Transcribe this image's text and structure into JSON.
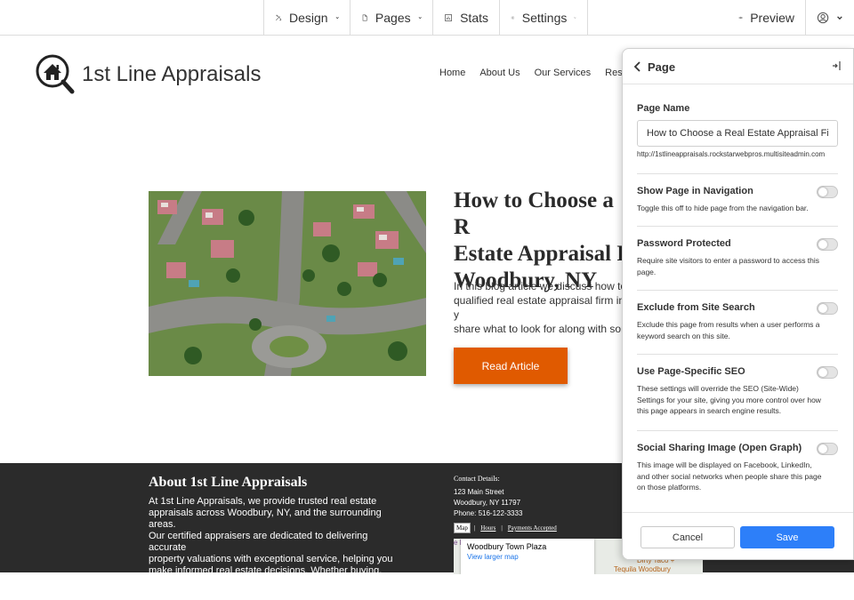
{
  "toolbar": {
    "design_label": "Design",
    "pages_label": "Pages",
    "stats_label": "Stats",
    "settings_label": "Settings",
    "preview_label": "Preview"
  },
  "site": {
    "name": "1st Line Appraisals",
    "nav": [
      "Home",
      "About Us",
      "Our Services",
      "Resour"
    ]
  },
  "article": {
    "title": "How to Choose a R\nEstate Appraisal F\nWoodbury, NY",
    "excerpt": "In this blog article we discuss how to\nqualified real estate appraisal firm in y\nshare what to look for along with som\nchoosing the best firm to meet your n",
    "read_label": "Read Article"
  },
  "footer": {
    "title": "About 1st Line Appraisals",
    "text": "At 1st Line Appraisals, we provide trusted real estate\nappraisals across Woodbury, NY, and the surrounding areas.\nOur certified appraisers are dedicated to delivering accurate\nproperty valuations with exceptional service, helping you\nmake informed real estate decisions. Whether buying,\nselling, or refinancing, we're here to support you every step\nof the way.",
    "contact_heading": "Contact Details:",
    "address1": "123 Main Street",
    "address2": "Woodbury, NY 11797",
    "phone": "Phone: 516-122-3333",
    "map_tabs": [
      "Map",
      "Hours",
      "Payments Accepted"
    ],
    "map_place": "Woodbury Town Plaza",
    "map_link": "View larger map",
    "map_label_1": "e Mansion",
    "map_label_2": "Dirty Taco +",
    "map_label_3": "Tequila Woodbury"
  },
  "panel": {
    "title": "Page",
    "page_name_label": "Page Name",
    "page_name_value": "How to Choose a Real Estate Appraisal Firm",
    "url": "http://1stlineappraisals.rockstarwebpros.multisiteadmin.com",
    "options": [
      {
        "label": "Show Page in Navigation",
        "desc": "Toggle this off to hide page from the navigation bar.",
        "enabled": false
      },
      {
        "label": "Password Protected",
        "desc": "Require site visitors to enter a password to access this\npage.",
        "enabled": false
      },
      {
        "label": "Exclude from Site Search",
        "desc": "Exclude this page from results when a user performs a\nkeyword search on this site.",
        "enabled": false
      },
      {
        "label": "Use Page-Specific SEO",
        "desc": "These settings will override the SEO (Site-Wide)\nSettings for your site, giving you more control over how\nthis page appears in search engine results.",
        "enabled": false
      },
      {
        "label": "Social Sharing Image (Open Graph)",
        "desc": "This image will be displayed on Facebook, LinkedIn,\nand other social networks when people share this page\non those platforms.",
        "enabled": false
      }
    ],
    "cancel_label": "Cancel",
    "save_label": "Save"
  },
  "colors": {
    "accent_orange": "#e05a00",
    "save_blue": "#2d7ff9",
    "footer_bg": "#2b2b2b"
  }
}
